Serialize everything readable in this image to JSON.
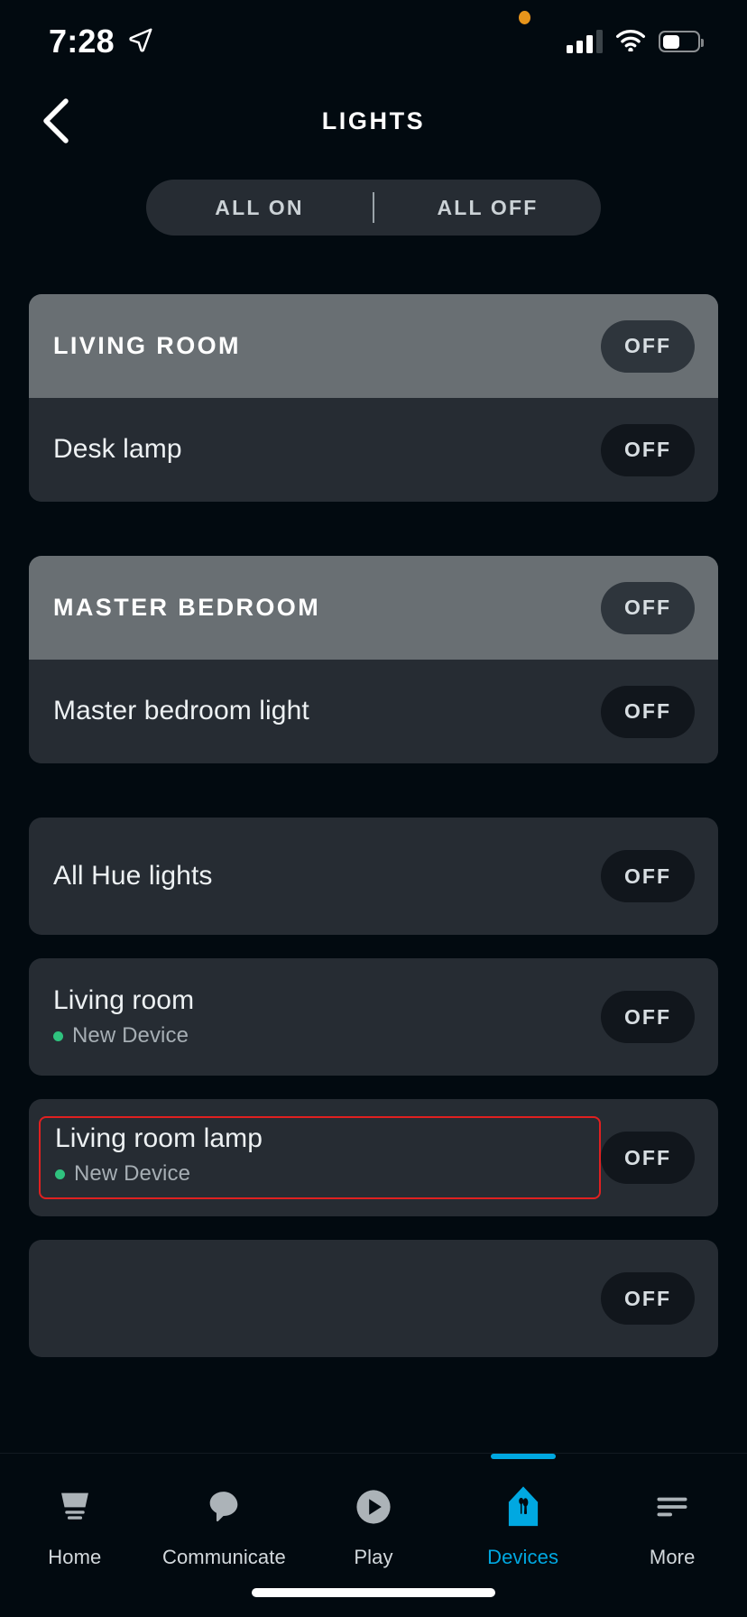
{
  "status_bar": {
    "time": "7:28",
    "location_icon": "location-arrow-icon",
    "recording_dot_color": "#E8951B",
    "signal_icon": "cellular-signal-icon",
    "signal_bars_filled": 3,
    "signal_bars_total": 4,
    "wifi_icon": "wifi-icon",
    "battery_icon": "battery-icon",
    "battery_percent": 43
  },
  "nav": {
    "back_icon": "chevron-left-icon",
    "title": "LIGHTS"
  },
  "bulk_controls": {
    "all_on_label": "ALL ON",
    "all_off_label": "ALL OFF"
  },
  "groups": [
    {
      "name": "LIVING ROOM",
      "state_label": "OFF",
      "devices": [
        {
          "name": "Desk lamp",
          "state_label": "OFF",
          "subtitle": null
        }
      ]
    },
    {
      "name": "MASTER BEDROOM",
      "state_label": "OFF",
      "devices": [
        {
          "name": "Master bedroom light",
          "state_label": "OFF",
          "subtitle": null
        }
      ]
    }
  ],
  "devices": [
    {
      "name": "All Hue lights",
      "state_label": "OFF",
      "subtitle": null,
      "highlighted": false
    },
    {
      "name": "Living room",
      "state_label": "OFF",
      "subtitle": "New Device",
      "subtitle_dot_color": "#2FC27E",
      "highlighted": false
    },
    {
      "name": "Living room lamp",
      "state_label": "OFF",
      "subtitle": "New Device",
      "subtitle_dot_color": "#2FC27E",
      "highlighted": true,
      "highlight_color": "#E02020"
    },
    {
      "name": "",
      "state_label": "OFF",
      "subtitle": null,
      "highlighted": false
    }
  ],
  "tab_bar": {
    "active": "Devices",
    "accent_color": "#00A8E1",
    "items": [
      {
        "label": "Home",
        "icon": "home-icon"
      },
      {
        "label": "Communicate",
        "icon": "speech-bubble-icon"
      },
      {
        "label": "Play",
        "icon": "play-circle-icon"
      },
      {
        "label": "Devices",
        "icon": "devices-house-icon"
      },
      {
        "label": "More",
        "icon": "more-lines-icon"
      }
    ]
  }
}
